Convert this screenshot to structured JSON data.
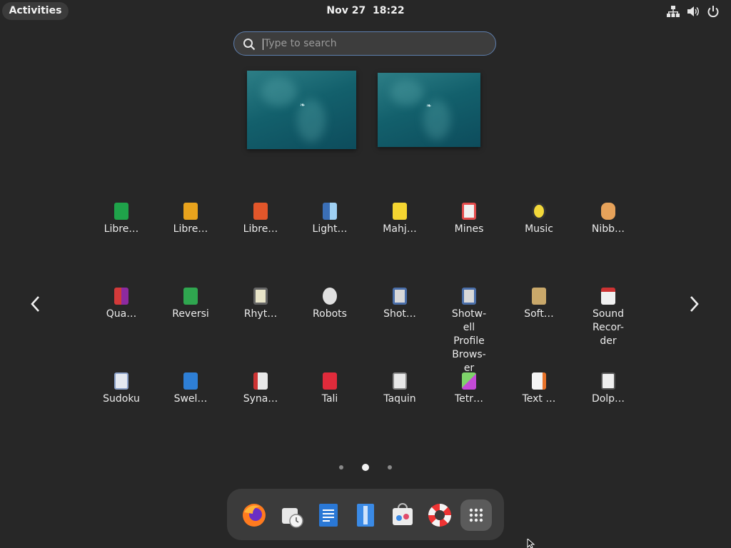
{
  "topbar": {
    "activities_label": "Activities",
    "date": "Nov 27",
    "time": "18:22",
    "icons": [
      "network-icon",
      "volume-icon",
      "power-icon"
    ]
  },
  "search": {
    "placeholder": "Type to search"
  },
  "app_grid": {
    "rows": [
      [
        "Libre…",
        "Libre…",
        "Libre…",
        "Light…",
        "Mahj…",
        "Mines",
        "Music",
        "Nibb…"
      ],
      [
        "Qua…",
        "Reversi",
        "Rhyt…",
        "Robots",
        "Shot…",
        "Shotw-\nell\nProfile\nBrows-\ner",
        "Soft…",
        "Sound\nRecor-\nder"
      ],
      [
        "Sudoku",
        "Swel…",
        "Syna…",
        "Tali",
        "Taquin",
        "Tetr…",
        "Text …",
        "Dolp…"
      ]
    ],
    "current_page": 2,
    "page_count": 3
  },
  "dash": {
    "items": [
      "firefox-icon",
      "clocks-icon",
      "writer-icon",
      "document-viewer-icon",
      "software-icon",
      "help-icon",
      "show-apps-icon"
    ]
  },
  "colors": {
    "background": "#272727",
    "accent": "#5e7fae"
  }
}
